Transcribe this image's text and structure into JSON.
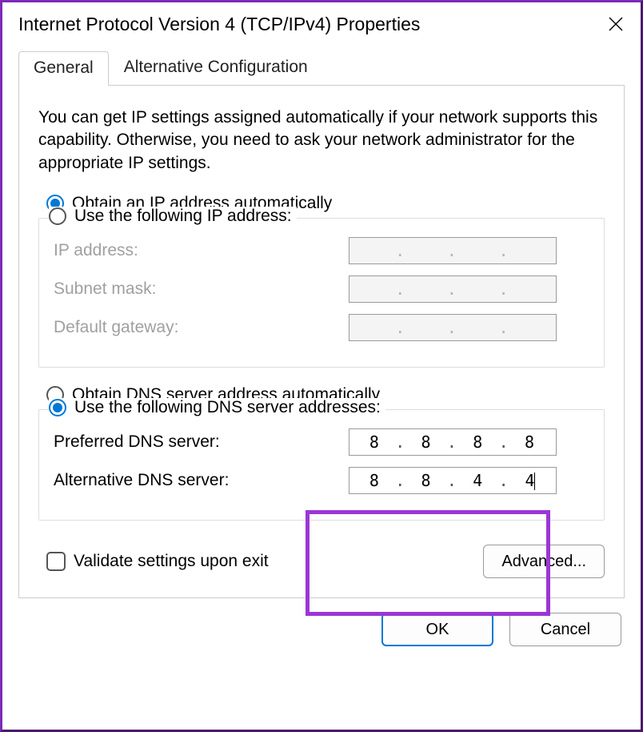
{
  "window": {
    "title": "Internet Protocol Version 4 (TCP/IPv4) Properties"
  },
  "tabs": {
    "general": "General",
    "alt": "Alternative Configuration"
  },
  "intro": "You can get IP settings assigned automatically if your network supports this capability. Otherwise, you need to ask your network administrator for the appropriate IP settings.",
  "ip": {
    "auto_label": "Obtain an IP address automatically",
    "manual_label": "Use the following IP address:",
    "ip_address_label": "IP address:",
    "subnet_label": "Subnet mask:",
    "gateway_label": "Default gateway:",
    "mode": "auto"
  },
  "dns": {
    "auto_label": "Obtain DNS server address automatically",
    "manual_label": "Use the following DNS server addresses:",
    "preferred_label": "Preferred DNS server:",
    "alternate_label": "Alternative DNS server:",
    "preferred": {
      "a": "8",
      "b": "8",
      "c": "8",
      "d": "8"
    },
    "alternate": {
      "a": "8",
      "b": "8",
      "c": "4",
      "d": "4"
    },
    "mode": "manual"
  },
  "validate_label": "Validate settings upon exit",
  "advanced_label": "Advanced...",
  "ok_label": "OK",
  "cancel_label": "Cancel"
}
